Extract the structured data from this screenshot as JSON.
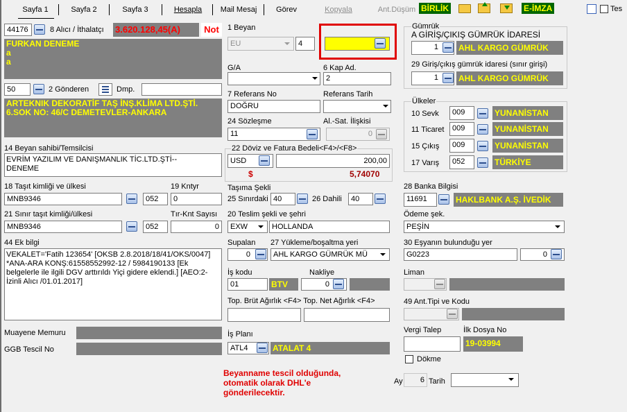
{
  "tabs": [
    {
      "label": "Sayfa 1",
      "u": "1"
    },
    {
      "label": "Sayfa 2",
      "u": "2"
    },
    {
      "label": "Sayfa 3",
      "u": "3"
    }
  ],
  "toolbar": {
    "hesapla": "Hesapla",
    "mail": "Mail Mesaj",
    "gorev": "Görev",
    "kopyala": "Kopyala",
    "ant_dusum": "Ant.Düşüm",
    "birlik": "BİRLİK",
    "eimza": "E-İMZA",
    "tes": "Tes"
  },
  "ithalatci": {
    "code": "44176",
    "label": "8 Alıcı / İthalatçı",
    "amount": "3.620.128,45(A)",
    "not": "Not",
    "name": "FURKAN DENEME\na\na"
  },
  "gonderen": {
    "code": "50",
    "label": "2 Gönderen",
    "dmp": "Dmp.",
    "dmp_value": "",
    "name": "ARTEKNIK DEKORATİF TAŞ İNŞ.KLİMA LTD.ŞTİ.\n6.SOK NO: 46/C DEMETEVLER-ANKARA"
  },
  "beyan_sahibi": {
    "label": "14 Beyan sahibi/Temsilcisi",
    "value": "EVRİM YAZILIM VE DANIŞMANLIK TİC.LTD.ŞTİ--\nDENEME"
  },
  "tasit": {
    "label": "18 Taşıt kimliği ve ülkesi",
    "value": "MNB9346",
    "country": "052",
    "kntyr_label": "19 Kntyr",
    "kntyr": "0"
  },
  "sinir_tasit": {
    "label": "21 Sınır taşıt kimliği/ülkesi",
    "value": "MNB9346",
    "country": "052",
    "tir_label": "Tır-Knt Sayısı",
    "tir": "0"
  },
  "ek_bilgi": {
    "label": "44 Ek bilgi",
    "value": "VEKALET='Fatih 123654' [OKSB 2.8.2018/18/41/OKS/0047] *ANA-ARA KONŞ:61558552992-12 / 5984190133 [Ek belgelerle ile ilgili DGV arttırıldı Yiçi gidere eklendi.] [AEO:2-İzinli Alıcı /01.01.2017]"
  },
  "muayene": {
    "label": "Muayene Memuru"
  },
  "ggb": {
    "label": "GGB Tescil No"
  },
  "beyan": {
    "label": "1 Beyan",
    "first": "EU",
    "second": "4"
  },
  "ga": {
    "label": "G/A"
  },
  "kap": {
    "label": "6 Kap Ad.",
    "value": "2"
  },
  "referans": {
    "label": "7 Referans No",
    "value": "DOĞRU",
    "tarih_label": "Referans Tarih"
  },
  "sozlesme": {
    "label": "24 Sözleşme",
    "value": "11",
    "al_sat_label": "Al.-Sat. İlişkisi",
    "al_sat": "0"
  },
  "doviz": {
    "label": "22 Döviz ve Fatura Bedeli<F4>/<F8>",
    "currency": "USD",
    "amount": "200,00",
    "dollar": "$",
    "rate": "5,74070"
  },
  "tasima": {
    "label": "Taşıma Şekli",
    "sinir_label": "25 Sınırdaki",
    "sinir": "40",
    "dahili_label": "26 Dahili",
    "dahili": "40"
  },
  "teslim": {
    "label": "20 Teslim şekli ve şehri",
    "sekil": "EXW",
    "sehir": "HOLLANDA"
  },
  "supalan": {
    "label": "Supalan",
    "value": "0",
    "yukleme_label": "27 Yükleme/boşaltma yeri",
    "yukleme": "AHL KARGO GÜMRÜK MÜ"
  },
  "is_kodu": {
    "label": "İş kodu",
    "value": "01",
    "tag": "BTV",
    "nakliye_label": "Nakliye",
    "nakliye": "0"
  },
  "agirlik": {
    "label": "Top. Brüt Ağırlık <F4> Top. Net Ağırlık <F4>"
  },
  "is_plani": {
    "label": "İş Planı",
    "code": "ATL4",
    "name": "ATALAT 4"
  },
  "notice": "Beyanname tescil olduğunda,\notomatik olarak DHL'e\ngönderilecektir.",
  "gumruk": {
    "label": "Gümrük",
    "giris_label": "A GİRİŞ/ÇIKIŞ GÜMRÜK İDARESİ",
    "giris_code": "1",
    "giris_name": "AHL KARGO GÜMRÜK",
    "sinir_label": "29 Giriş/çıkış gümrük idaresi (sınır girişi)",
    "sinir_code": "1",
    "sinir_name": "AHL KARGO GÜMRÜK"
  },
  "ulkeler": {
    "label": "Ülkeler",
    "rows": [
      {
        "label": "10 Sevk",
        "code": "009",
        "name": "YUNANİSTAN"
      },
      {
        "label": "11 Ticaret",
        "code": "009",
        "name": "YUNANİSTAN"
      },
      {
        "label": "15 Çıkış",
        "code": "009",
        "name": "YUNANİSTAN"
      },
      {
        "label": "17 Varış",
        "code": "052",
        "name": "TÜRKİYE"
      }
    ]
  },
  "banka": {
    "label": "28 Banka Bilgisi",
    "code": "11691",
    "name": "HAKLBANK A.Ş. İVEDİK"
  },
  "odeme": {
    "label": "Ödeme şek.",
    "value": "PEŞİN"
  },
  "esya": {
    "label": "30 Eşyanın bulunduğu yer",
    "value": "G0223",
    "num": "0"
  },
  "liman": {
    "label": "Liman"
  },
  "ant_tipi": {
    "label": "49 Ant.Tipi ve Kodu"
  },
  "vergi": {
    "label": "Vergi Talep",
    "ilk_label": "İlk Dosya No",
    "ilk": "19-03994"
  },
  "dokme": {
    "label": "Dökme"
  },
  "ay": {
    "label": "Ay",
    "value": "6",
    "tarih_label": "Tarih"
  }
}
